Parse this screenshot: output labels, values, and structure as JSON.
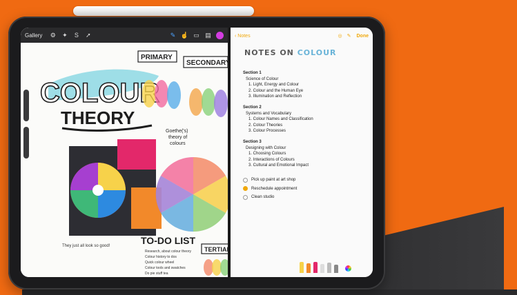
{
  "colors": {
    "background": "#f06a12",
    "accent": "#f0a80a",
    "brush_pink": "#d23ce0"
  },
  "procreate_toolbar": {
    "gallery_label": "Gallery",
    "icons": [
      "wrench-icon",
      "magic-wand-icon",
      "selection-icon",
      "move-icon",
      "brush-icon",
      "smudge-icon",
      "eraser-icon",
      "layers-icon",
      "color-picker-icon"
    ]
  },
  "canvas": {
    "title_line1": "COLOUR",
    "title_line2": "THEORY",
    "label_primary": "PRIMARY",
    "label_secondary": "SECONDARY",
    "label_tertiary": "TERTIARY",
    "goethe_note_line1": "Goethe('s)",
    "goethe_note_line2": "theory of",
    "goethe_note_line3": "colours",
    "todo_title": "TO-DO LIST",
    "they_note": "They just all look so good!",
    "todo_item_1": "Research, about colour theory",
    "todo_item_2": "Colour history to dos",
    "todo_item_3": "Quick colour wheel",
    "todo_item_4": "Colour tools and swatches",
    "todo_item_5": "Do pie stuff tea"
  },
  "notes": {
    "back_label": "Notes",
    "done_label": "Done",
    "title_prefix": "NOTES ON",
    "title_accent": "COLOUR",
    "sections": [
      {
        "heading": "Section 1",
        "subtitle": "Science of Colour",
        "items": [
          "1. Light, Energy and Colour",
          "2. Colour and the Human Eye",
          "3. Illumination and Reflection"
        ]
      },
      {
        "heading": "Section 2",
        "subtitle": "Systems and Vocabulary",
        "items": [
          "1. Colour Names and Classification",
          "2. Colour Theories",
          "3. Colour Processes"
        ]
      },
      {
        "heading": "Section 3",
        "subtitle": "Designing with Colour",
        "items": [
          "1. Choosing Colours",
          "2. Interactions of Colours",
          "3. Cultural and Emotional Impact"
        ]
      }
    ],
    "checklist": [
      {
        "text": "Pick up paint at art shop",
        "checked": false
      },
      {
        "text": "Reschedule appointment",
        "checked": true
      },
      {
        "text": "Clean studio",
        "checked": false
      }
    ]
  }
}
